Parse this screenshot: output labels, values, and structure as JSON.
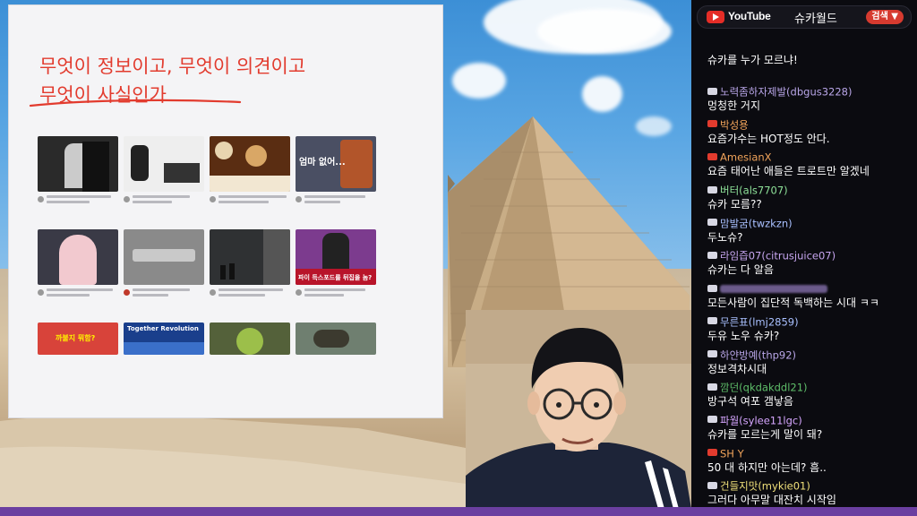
{
  "slide": {
    "title_line1": "무엇이 정보이고, 무엇이 의견이고",
    "title_line2": "무엇이 사실인가",
    "thumb_texts": {
      "t4": "엄마 없어...",
      "t8": "파이 득스포드를 뒤집을 놈?",
      "t9": "까불지 뭐함?",
      "t10": "Together Revolution"
    }
  },
  "chat": {
    "platform": "YouTube",
    "channel": "슈카월드",
    "search_label": "검색",
    "first_text": "슈카를 누가 모르냐!",
    "messages": [
      {
        "name": "노력좀하자제발(dbgus3228)",
        "text": "멍청한 거지",
        "badge": "gray",
        "name_color": "#b9a6e8"
      },
      {
        "name": "박성용",
        "text": "요즘가수는 HOT정도 안다.",
        "badge": "red",
        "name_color": "#f0a35a"
      },
      {
        "name": "AmesianX",
        "text": "요즘 태어난 애들은 트로트만 알겠네",
        "badge": "red",
        "name_color": "#f0a35a"
      },
      {
        "name": "버터(als7707)",
        "text": "슈카 모름??",
        "badge": "gray",
        "name_color": "#8fe39a"
      },
      {
        "name": "맘발굼(twzkzn)",
        "text": "두노슈?",
        "badge": "gray",
        "name_color": "#a9c0ff"
      },
      {
        "name": "라임즙07(citrusjuice07)",
        "text": "슈카는 다 알음",
        "badge": "gray",
        "name_color": "#c7a6f0"
      },
      {
        "name": "",
        "text": "모든사람이 집단적 독백하는 시대 ㅋㅋ",
        "badge": "gray",
        "name_color": "#c7a6f0"
      },
      {
        "name": "무른표(lmj2859)",
        "text": "두유 노우 슈카?",
        "badge": "gray",
        "name_color": "#a9c0ff"
      },
      {
        "name": "하얀방예(thp92)",
        "text": "정보격차시대",
        "badge": "gray",
        "name_color": "#b9a6e8"
      },
      {
        "name": "깜던(qkdakddl21)",
        "text": "방구석 여포 갬낳음",
        "badge": "gray",
        "name_color": "#5fbf6a"
      },
      {
        "name": "파월(sylee11lgc)",
        "text": "슈카를 모르는게 말이 돼?",
        "badge": "gray",
        "name_color": "#d6a6ff"
      },
      {
        "name": "SH Y",
        "text": "50 대 하지만 아는데? 흠..",
        "badge": "red",
        "name_color": "#f0a35a"
      },
      {
        "name": "건들지맛(mykie01)",
        "text": "그러다 아무말 대잔치 시작임",
        "badge": "gray",
        "name_color": "#f0e07a"
      }
    ]
  },
  "colors": {
    "accent": "#e23b2e",
    "chat_bg": "#0b0b10",
    "bottom_bar": "#6b3fa0"
  }
}
